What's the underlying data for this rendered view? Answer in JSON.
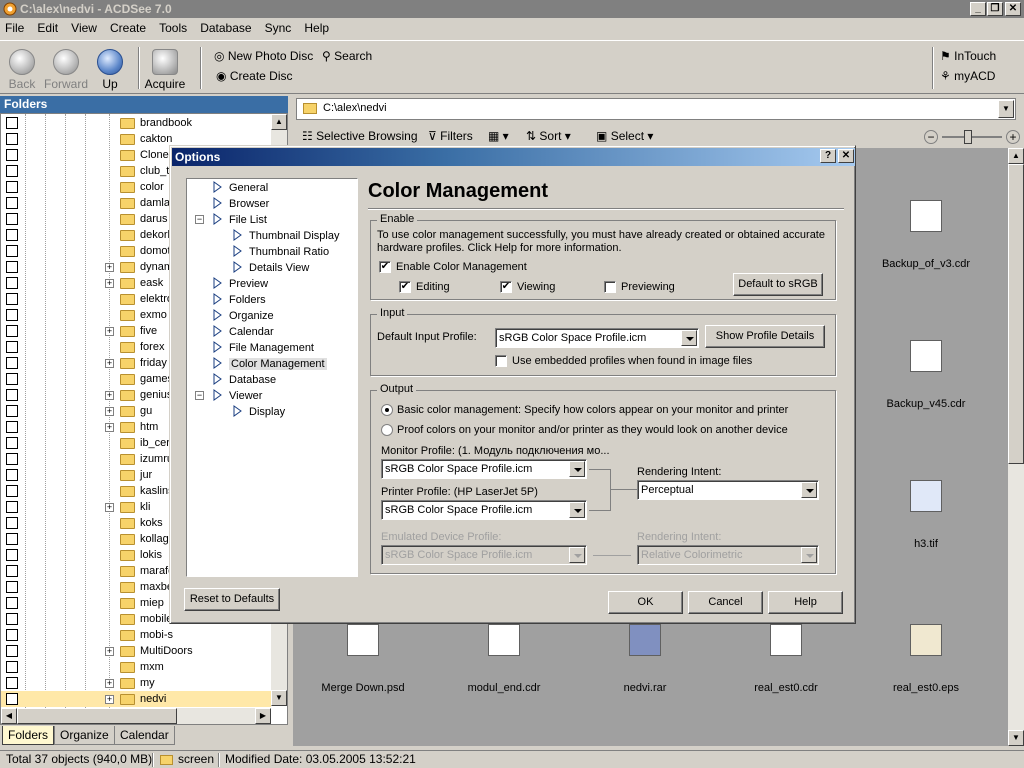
{
  "window": {
    "title": "C:\\alex\\nedvi - ACDSee 7.0"
  },
  "menu": [
    "File",
    "Edit",
    "View",
    "Create",
    "Tools",
    "Database",
    "Sync",
    "Help"
  ],
  "toolbar": {
    "back": "Back",
    "forward": "Forward",
    "up": "Up",
    "acquire": "Acquire",
    "new_photo_disc": "New Photo Disc",
    "search": "Search",
    "create_disc": "Create Disc",
    "intouch": "InTouch",
    "myacd": "myACD"
  },
  "folders": {
    "header": "Folders",
    "items": [
      "brandbook",
      "cakton",
      "Clonec",
      "club_t",
      "color",
      "damla",
      "darus",
      "dekorl",
      "domot",
      "dynam",
      "eask",
      "elektro",
      "exmo",
      "five",
      "forex",
      "friday",
      "games",
      "genius",
      "gu",
      "htm",
      "ib_cer",
      "izumru",
      "jur",
      "kaslins",
      "kli",
      "koks",
      "kollage",
      "lokis",
      "marafo",
      "maxbe",
      "miep",
      "mobile",
      "mobi-s",
      "MultiDoors",
      "mxm",
      "my",
      "nedvi"
    ],
    "tabs": [
      "Folders",
      "Organize",
      "Calendar"
    ]
  },
  "path": "C:\\alex\\nedvi",
  "filterbar": {
    "selective": "Selective Browsing",
    "filters": "Filters",
    "sort": "Sort",
    "select": "Select"
  },
  "files": [
    {
      "name": "Backup_of_v3.cdr"
    },
    {
      "name": "Backup_v45.cdr"
    },
    {
      "name": "h3.tif"
    },
    {
      "name": "Merge Down.psd"
    },
    {
      "name": "modul_end.cdr"
    },
    {
      "name": "nedvi.rar"
    },
    {
      "name": "real_est0.cdr"
    },
    {
      "name": "real_est0.eps"
    }
  ],
  "status": {
    "total": "Total 37 objects  (940,0 MB)",
    "folder": "screen",
    "modified": "Modified Date: 03.05.2005 13:52:21"
  },
  "dialog": {
    "title": "Options",
    "tree": [
      "General",
      "Browser",
      "File List",
      "Thumbnail Display",
      "Thumbnail Ratio",
      "Details View",
      "Preview",
      "Folders",
      "Organize",
      "Calendar",
      "File Management",
      "Color Management",
      "Database",
      "Viewer",
      "Display"
    ],
    "heading": "Color Management",
    "enable": {
      "title": "Enable",
      "text": "To use color management successfully, you must have already created or obtained accurate hardware profiles. Click Help for more information.",
      "enable_cm": "Enable Color Management",
      "editing": "Editing",
      "viewing": "Viewing",
      "previewing": "Previewing",
      "default_srgb": "Default to sRGB"
    },
    "input": {
      "title": "Input",
      "label": "Default Input Profile:",
      "value": "sRGB Color Space Profile.icm",
      "show_details": "Show Profile Details",
      "use_embedded": "Use embedded profiles when found in image files"
    },
    "output": {
      "title": "Output",
      "basic": "Basic color management: Specify how colors appear on your monitor and printer",
      "proof": "Proof colors on your monitor and/or printer as they would look on another device",
      "monitor_label": "Monitor Profile: (1. Модуль подключения мо...",
      "monitor_value": "sRGB Color Space Profile.icm",
      "printer_label": "Printer Profile: (HP LaserJet 5P)",
      "printer_value": "sRGB Color Space Profile.icm",
      "intent_label": "Rendering Intent:",
      "intent_value": "Perceptual",
      "emulated_label": "Emulated Device Profile:",
      "emulated_value": "sRGB Color Space Profile.icm",
      "intent2_label": "Rendering Intent:",
      "intent2_value": "Relative Colorimetric"
    },
    "reset": "Reset to Defaults",
    "ok": "OK",
    "cancel": "Cancel",
    "help": "Help"
  }
}
